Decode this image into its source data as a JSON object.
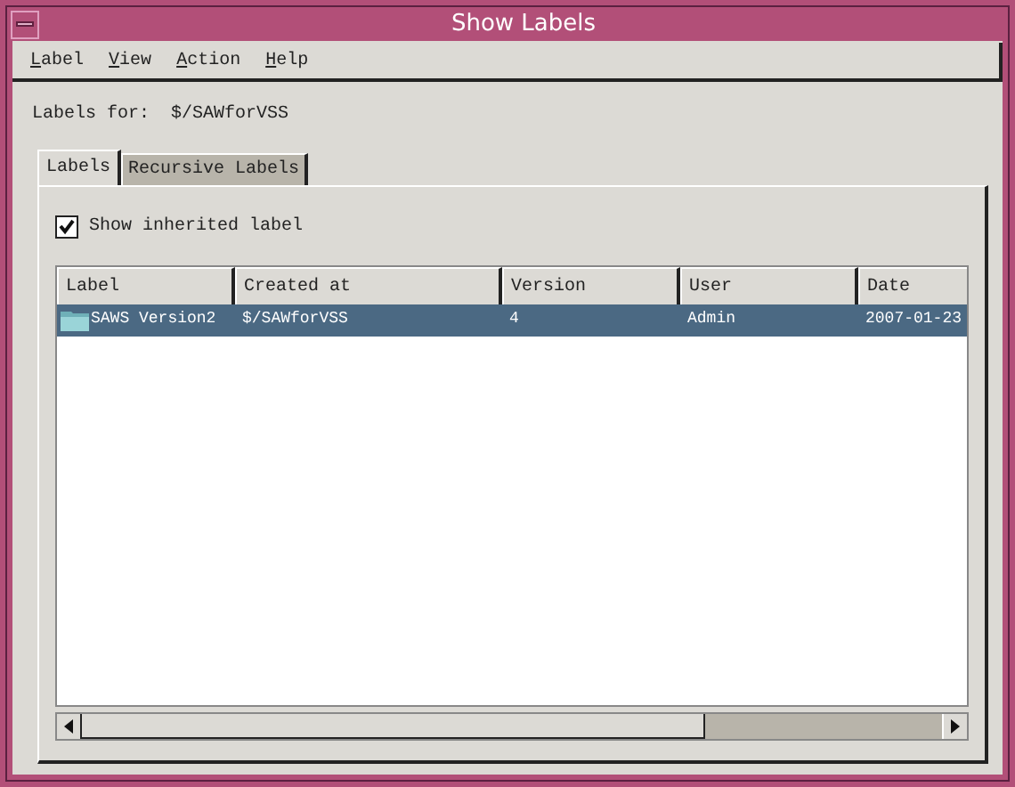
{
  "window": {
    "title": "Show Labels"
  },
  "menu": [
    "Label",
    "View",
    "Action",
    "Help"
  ],
  "labels_for": {
    "label": "Labels for:",
    "value": "$/SAWforVSS"
  },
  "tabs": [
    {
      "label": "Labels",
      "selected": true
    },
    {
      "label": "Recursive Labels",
      "selected": false
    }
  ],
  "show_inherited": {
    "label": "Show inherited label",
    "checked": true
  },
  "table": {
    "columns": [
      "Label",
      "Created at",
      "Version",
      "User",
      "Date"
    ],
    "rows": [
      {
        "selected": true,
        "cells": [
          "SAWS Version2",
          "$/SAWforVSS",
          "4",
          "Admin",
          "2007-01-23"
        ]
      }
    ]
  }
}
